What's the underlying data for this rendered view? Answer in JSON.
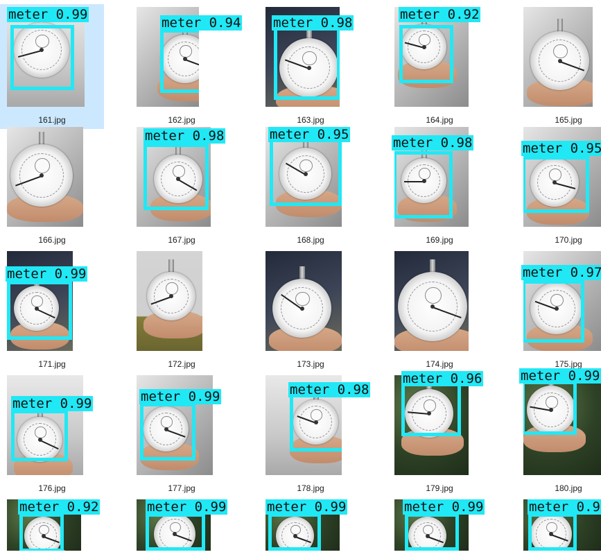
{
  "explorer": {
    "selected_file": "161.jpg",
    "accent_color": "#21e8f5",
    "selection_color": "#cce8ff",
    "files": [
      {
        "name": "161.jpg",
        "label": "meter 0.99"
      },
      {
        "name": "162.jpg",
        "label": "meter 0.94"
      },
      {
        "name": "163.jpg",
        "label": "meter 0.98"
      },
      {
        "name": "164.jpg",
        "label": "meter 0.92"
      },
      {
        "name": "165.jpg",
        "label": ""
      },
      {
        "name": "166.jpg",
        "label": ""
      },
      {
        "name": "167.jpg",
        "label": "meter 0.98"
      },
      {
        "name": "168.jpg",
        "label": "meter 0.95"
      },
      {
        "name": "169.jpg",
        "label": "meter 0.98"
      },
      {
        "name": "170.jpg",
        "label": "meter 0.95"
      },
      {
        "name": "171.jpg",
        "label": "meter 0.99"
      },
      {
        "name": "172.jpg",
        "label": ""
      },
      {
        "name": "173.jpg",
        "label": ""
      },
      {
        "name": "174.jpg",
        "label": ""
      },
      {
        "name": "175.jpg",
        "label": "meter 0.97"
      },
      {
        "name": "176.jpg",
        "label": "meter 0.99"
      },
      {
        "name": "177.jpg",
        "label": "meter 0.99"
      },
      {
        "name": "178.jpg",
        "label": "meter 0.98"
      },
      {
        "name": "179.jpg",
        "label": "meter 0.96"
      },
      {
        "name": "180.jpg",
        "label": "meter 0.99"
      },
      {
        "name": "",
        "label": "meter 0.92"
      },
      {
        "name": "",
        "label": "meter 0.99"
      },
      {
        "name": "",
        "label": "meter 0.99"
      },
      {
        "name": "",
        "label": "meter 0.99"
      },
      {
        "name": "",
        "label": "meter 0.9"
      }
    ]
  }
}
